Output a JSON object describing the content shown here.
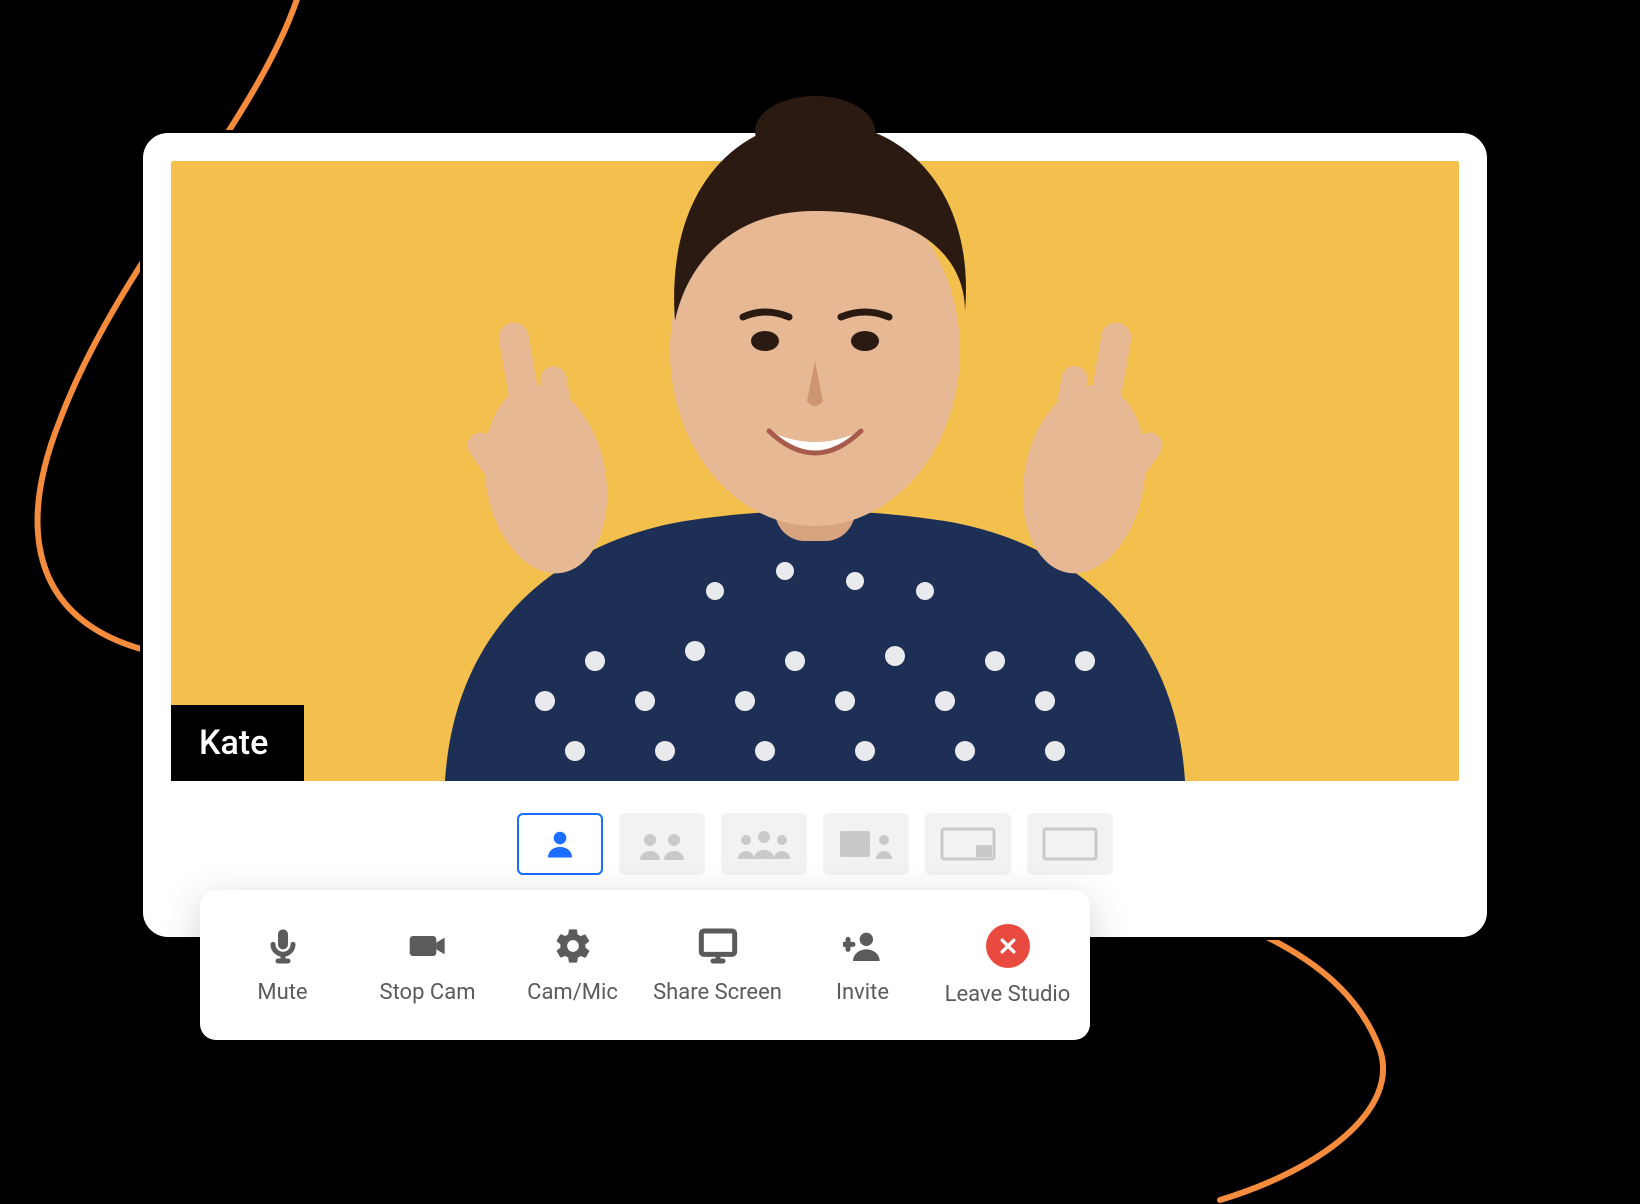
{
  "participant": {
    "name": "Kate"
  },
  "layouts": {
    "active_index": 0,
    "items": [
      {
        "id": "single"
      },
      {
        "id": "two-up"
      },
      {
        "id": "three-up"
      },
      {
        "id": "split"
      },
      {
        "id": "pip"
      },
      {
        "id": "blank"
      }
    ]
  },
  "toolbar": {
    "mute_label": "Mute",
    "stop_cam_label": "Stop Cam",
    "cam_mic_label": "Cam/Mic",
    "share_screen_label": "Share Screen",
    "invite_label": "Invite",
    "leave_label": "Leave Studio"
  },
  "colors": {
    "accent_blue": "#1a6dff",
    "video_bg": "#f4c04d",
    "leave_red": "#e84a3f",
    "swoosh": "#f58b3c"
  }
}
